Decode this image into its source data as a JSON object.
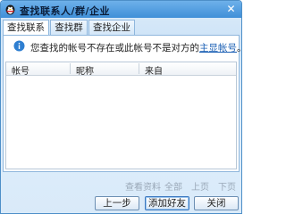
{
  "window": {
    "title": "查找联系人/群/企业",
    "close_glyph": "✕"
  },
  "tabs": [
    {
      "label": "查找联系人",
      "active": true
    },
    {
      "label": "查找群",
      "active": false
    },
    {
      "label": "查找企业",
      "active": false
    }
  ],
  "info": {
    "message": "您查找的帐号不存在或此帐号不是对方的",
    "link": "主显帐号",
    "suffix": "。"
  },
  "table": {
    "columns": [
      "帐号",
      "昵称",
      "来自"
    ],
    "rows": []
  },
  "footer_links": [
    "查看资料",
    "全部",
    "上页",
    "下页"
  ],
  "buttons": {
    "prev": "上一步",
    "add_friend": "添加好友",
    "close": "关闭"
  },
  "colors": {
    "accent": "#3f8fd8",
    "link": "#1a5fb4"
  }
}
